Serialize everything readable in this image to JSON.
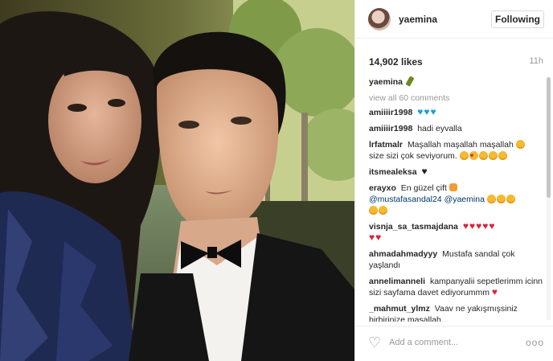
{
  "post": {
    "username": "yaemina",
    "follow_label": "Following",
    "likes": "14,902 likes",
    "time_ago": "11h"
  },
  "comments": {
    "caption_user": "yaemina",
    "view_all": "view all 60 comments",
    "items": [
      {
        "user": "amiiiir1998",
        "text": ""
      },
      {
        "user": "amiiiir1998",
        "text": "hadi eyvalla"
      },
      {
        "user": "lrfatmalr",
        "text": "Maşallah maşallah maşallah"
      },
      {
        "user": "itsmealeksa",
        "text": ""
      },
      {
        "user": "erayxo",
        "text": "En güzel çift"
      },
      {
        "user": "visnja_sa_tasmajdana",
        "text": ""
      },
      {
        "user": "ahmadahmadyyy",
        "text": "Mustafa sandal çok yaşlandı"
      },
      {
        "user": "annelimanneli",
        "text": "kampanyalii sepetlerimm icinn sizi sayfama davet ediyorummm"
      },
      {
        "user": "_mahmut_ylmz",
        "text": "Vaav ne yakışmışsiniz birbirinize maşallah..."
      }
    ],
    "fatma_line2": "size sizi çok seviyorum.",
    "mentions": [
      "@mustafasandal24",
      "@yaemina"
    ]
  },
  "footer": {
    "add_comment_placeholder": "Add a comment...",
    "more_label": "ooo"
  },
  "icons": {
    "like": "heart-outline-icon",
    "more": "more-options-icon"
  },
  "colors": {
    "accent_link": "#003569",
    "muted": "#999999",
    "border": "#efefef"
  }
}
